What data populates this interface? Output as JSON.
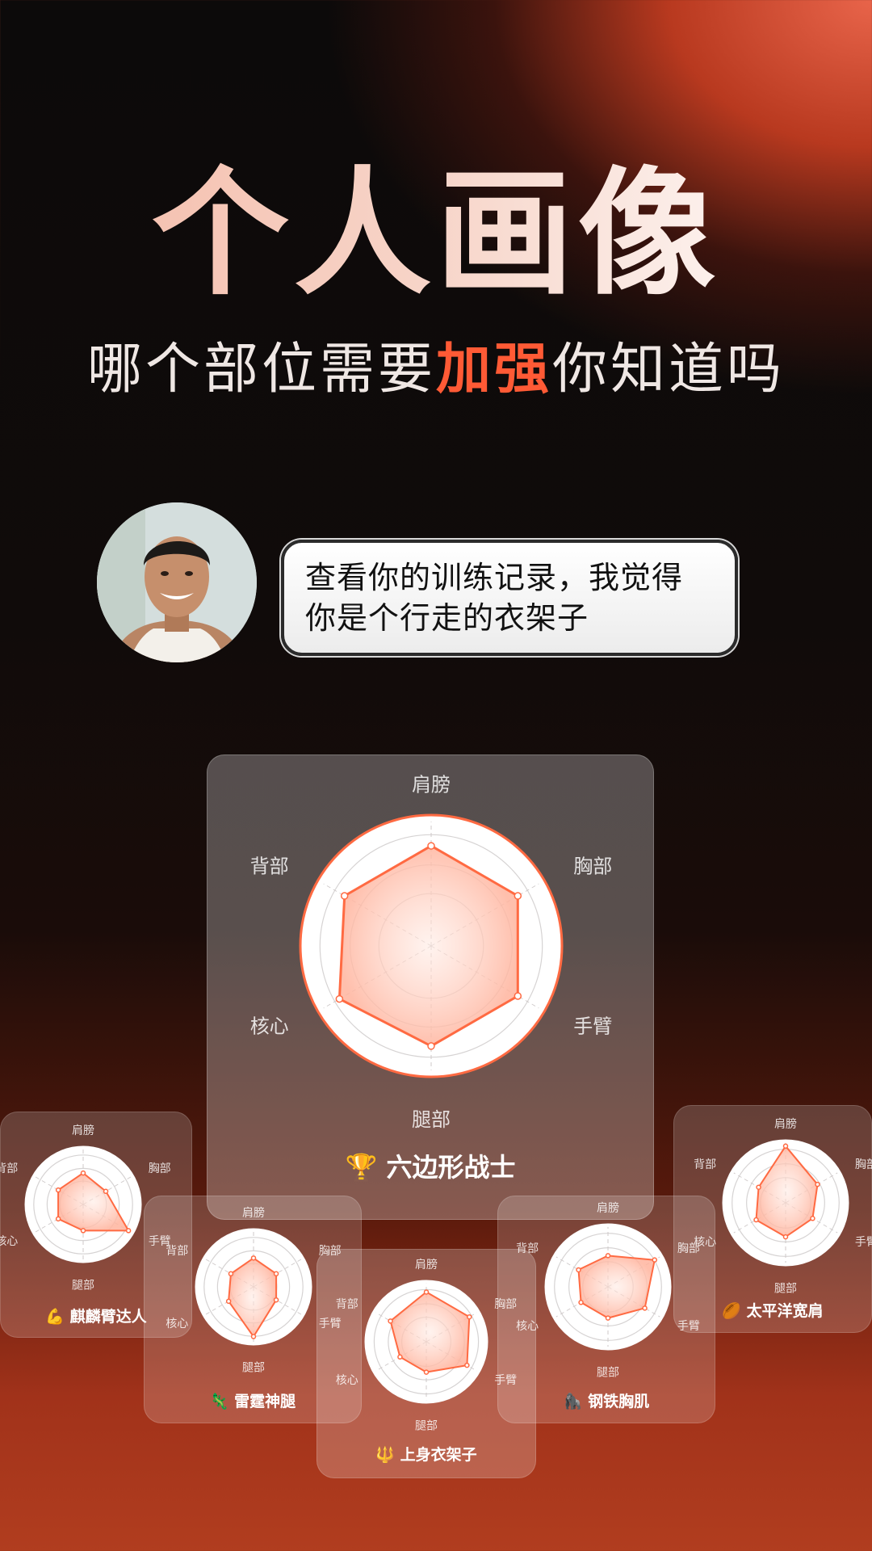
{
  "hero": {
    "title": "个人画像",
    "subtitle_pre": "哪个部位需要",
    "subtitle_highlight": "加强",
    "subtitle_post": "你知道吗"
  },
  "coach": {
    "speech_line1": "查看你的训练记录，我觉得",
    "speech_line2": "你是个行走的衣架子"
  },
  "axes": [
    "肩膀",
    "胸部",
    "手臂",
    "腿部",
    "核心",
    "背部"
  ],
  "colors": {
    "accent": "#ff5a35",
    "polygon_stroke": "#ff6a42",
    "polygon_fill": "#ffb49e"
  },
  "cards": [
    {
      "id": "main",
      "title": "六边形战士",
      "icon": "trophy-icon",
      "emoji": "🏆",
      "values": [
        0.85,
        0.85,
        0.85,
        0.85,
        0.9,
        0.85
      ]
    },
    {
      "id": "arm",
      "title": "麒麟臂达人",
      "icon": "flexed-biceps-icon",
      "emoji": "💪",
      "values": [
        0.6,
        0.5,
        1.0,
        0.5,
        0.55,
        0.55
      ]
    },
    {
      "id": "shoulder",
      "title": "太平洋宽肩",
      "icon": "rugby-ball-icon",
      "emoji": "🏉",
      "values": [
        1.0,
        0.65,
        0.55,
        0.6,
        0.6,
        0.55
      ]
    },
    {
      "id": "leg",
      "title": "雷霆神腿",
      "icon": "lizard-icon",
      "emoji": "🦎",
      "values": [
        0.55,
        0.5,
        0.5,
        0.95,
        0.55,
        0.5
      ]
    },
    {
      "id": "chest",
      "title": "钢铁胸肌",
      "icon": "gorilla-icon",
      "emoji": "🦍",
      "values": [
        0.55,
        0.95,
        0.75,
        0.55,
        0.55,
        0.6
      ]
    },
    {
      "id": "upper",
      "title": "上身衣架子",
      "icon": "trident-icon",
      "emoji": "🔱",
      "values": [
        0.9,
        0.9,
        0.85,
        0.55,
        0.55,
        0.75
      ]
    }
  ]
}
